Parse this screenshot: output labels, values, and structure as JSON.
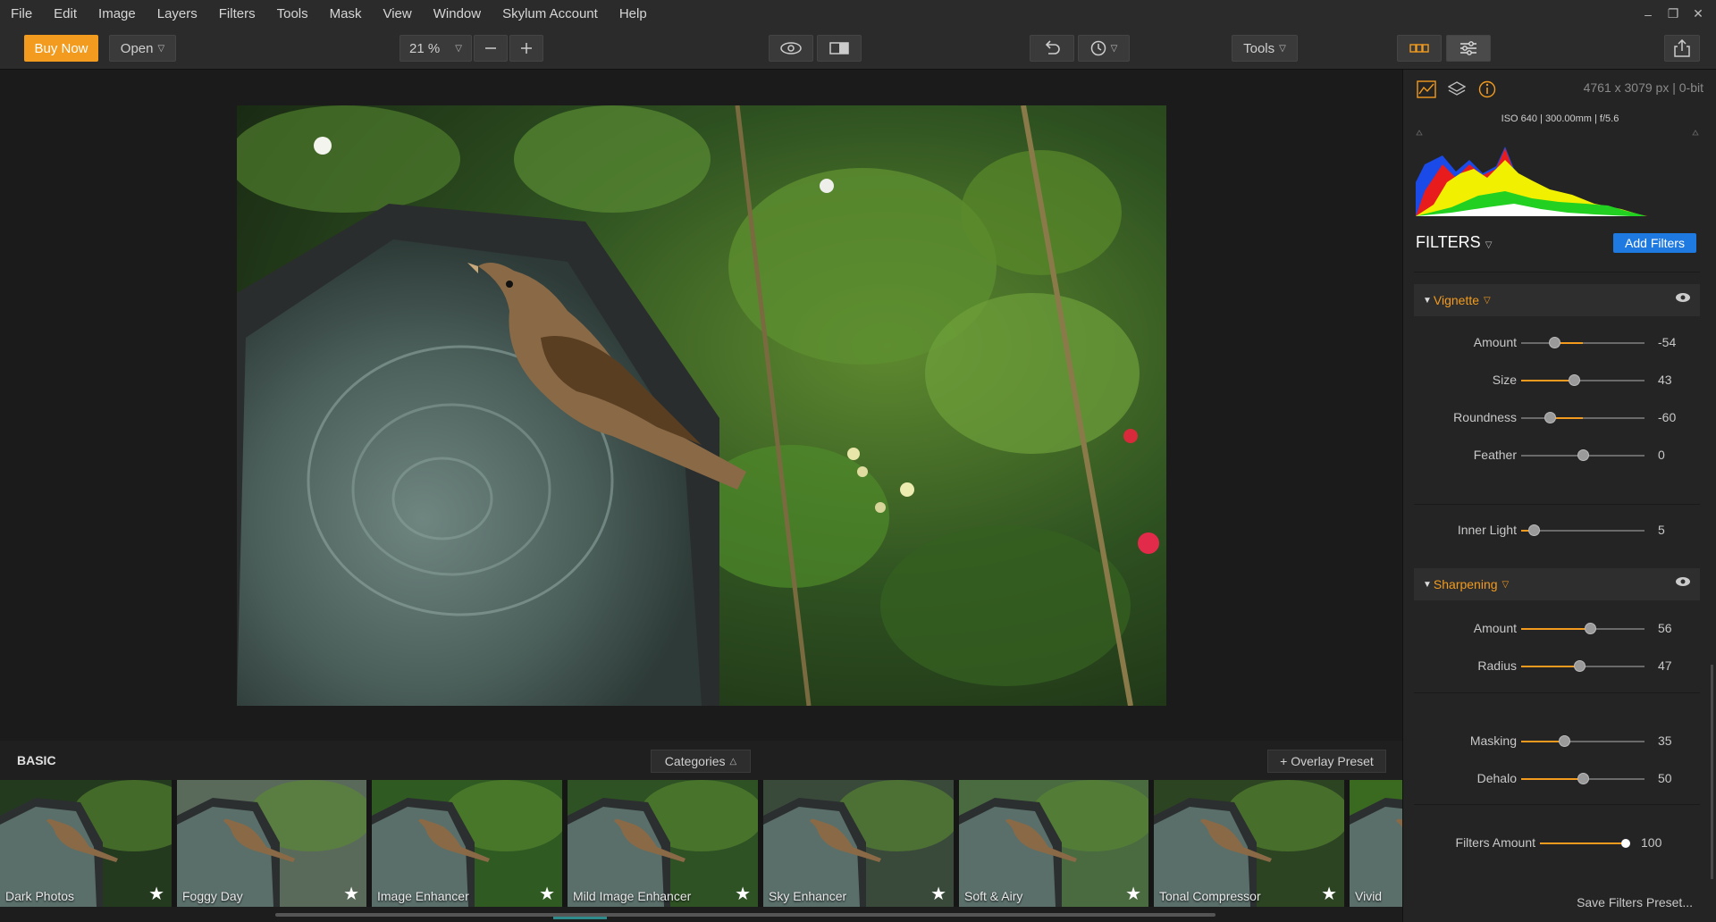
{
  "menu": [
    "File",
    "Edit",
    "Image",
    "Layers",
    "Filters",
    "Tools",
    "Mask",
    "View",
    "Window",
    "Skylum Account",
    "Help"
  ],
  "window_controls": [
    "–",
    "❐",
    "✕"
  ],
  "toolbar": {
    "buy_label": "Buy Now",
    "open_label": "Open",
    "zoom_value": "21 %",
    "tools_label": "Tools"
  },
  "info": {
    "dimensions": "4761 x 3079 px  |  0-bit",
    "exif": "ISO 640  |  300.00mm  |  f/5.6"
  },
  "filters_panel": {
    "title": "FILTERS",
    "add_label": "Add Filters",
    "vignette": {
      "title": "Vignette",
      "sliders": [
        {
          "label": "Amount",
          "value": "-54",
          "pos": 0.27
        },
        {
          "label": "Size",
          "value": "43",
          "pos": 0.43
        },
        {
          "label": "Roundness",
          "value": "-60",
          "pos": 0.23
        },
        {
          "label": "Feather",
          "value": "0",
          "pos": 0.5
        },
        {
          "label": "Inner Light",
          "value": "5",
          "pos": 0.1
        }
      ]
    },
    "sharpening": {
      "title": "Sharpening",
      "sliders": [
        {
          "label": "Amount",
          "value": "56",
          "pos": 0.56
        },
        {
          "label": "Radius",
          "value": "47",
          "pos": 0.47
        },
        {
          "label": "Masking",
          "value": "35",
          "pos": 0.35
        },
        {
          "label": "Dehalo",
          "value": "50",
          "pos": 0.5
        }
      ]
    },
    "filters_amount": {
      "label": "Filters Amount",
      "value": "100",
      "pos": 1.0
    },
    "save_label": "Save Filters Preset..."
  },
  "presets": {
    "section": "BASIC",
    "categories_label": "Categories",
    "overlay_label": "+ Overlay Preset",
    "items": [
      "Dark Photos",
      "Foggy Day",
      "Image Enhancer",
      "Mild Image Enhancer",
      "Sky Enhancer",
      "Soft & Airy",
      "Tonal Compressor",
      "Vivid"
    ]
  },
  "colors": {
    "accent": "#f29b1e",
    "primary": "#1e7ae0"
  }
}
